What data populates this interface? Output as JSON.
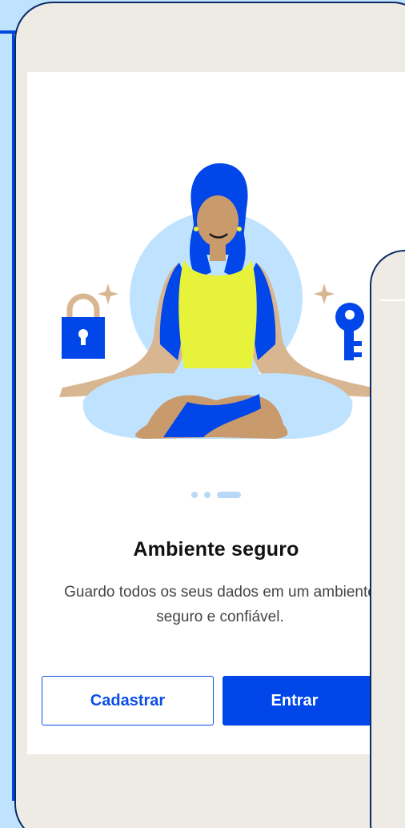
{
  "onboarding": {
    "title": "Ambiente seguro",
    "subtitle": "Guardo todos os seus dados em um ambiente seguro e confiável.",
    "page_indicator": {
      "total": 3,
      "active_index": 2
    },
    "illustration_icons": [
      "meditating-person-illustration",
      "padlock-icon",
      "key-icon",
      "sparkle-icon"
    ]
  },
  "actions": {
    "signup_label": "Cadastrar",
    "login_label": "Entrar"
  },
  "colors": {
    "brand_blue": "#0046e8",
    "light_blue": "#b8d8f6",
    "background_beige": "#edebe3"
  }
}
